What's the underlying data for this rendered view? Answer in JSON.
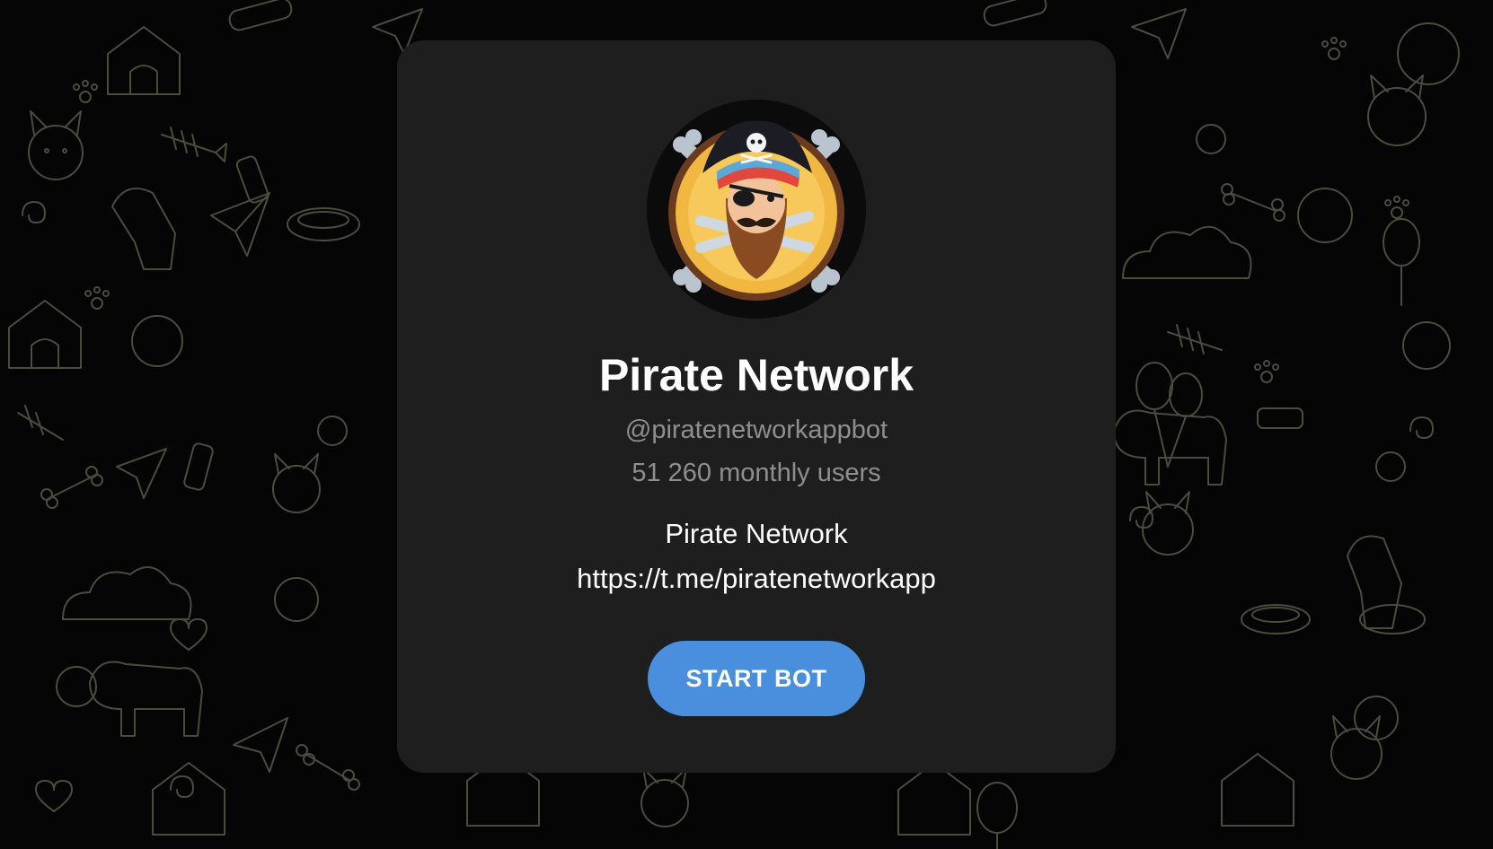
{
  "bot": {
    "name": "Pirate Network",
    "username": "@piratenetworkappbot",
    "monthly_users": "51 260 monthly users",
    "description_lines": [
      "Pirate Network",
      "https://t.me/piratenetworkapp"
    ]
  },
  "actions": {
    "start_label": "START BOT"
  },
  "icons": {
    "avatar": "pirate-avatar-icon",
    "background_pattern": "doodle-pattern"
  },
  "colors": {
    "page_background": "#050505",
    "card_background": "#1e1e1e",
    "button": "#4a8fdd",
    "primary_text": "#ffffff",
    "secondary_text": "#8f8f8f",
    "pattern_stroke": "#4a4c3c"
  }
}
